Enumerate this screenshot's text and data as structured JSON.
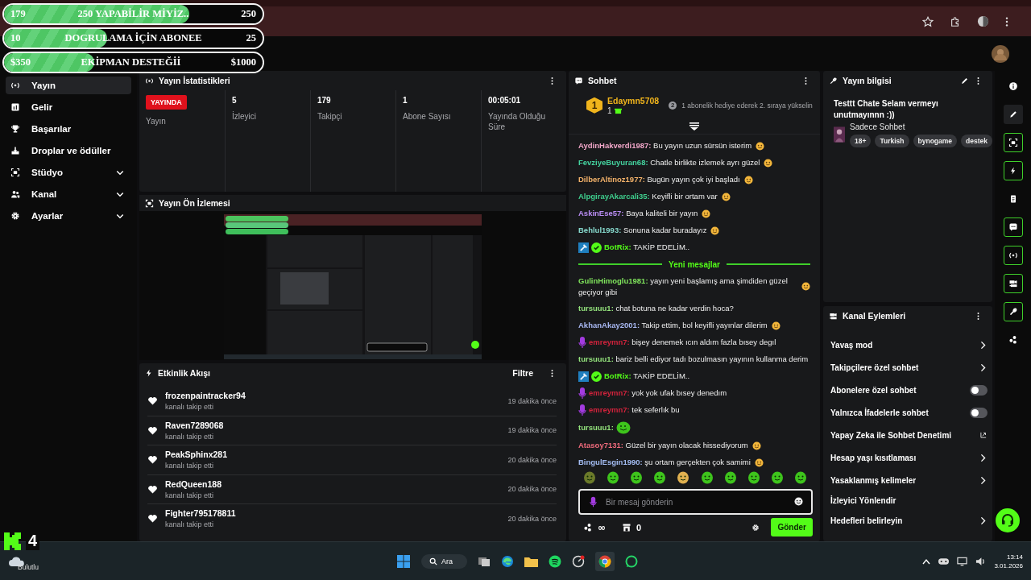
{
  "goals": [
    {
      "current": "179",
      "title": "250 YAPABİLİR MİYİZ..",
      "target": "250",
      "level": 0.716
    },
    {
      "current": "10",
      "title": "DOGRULAMA İÇİN ABONEE",
      "target": "25",
      "level": 0.4
    },
    {
      "current": "$350",
      "title": "EKİPMAN DESTEĞİİ",
      "target": "$1000",
      "level": 0.35
    }
  ],
  "sidebar": {
    "items": [
      {
        "label": "Yayın",
        "kind": "broadcast",
        "selected": true,
        "expandable": false
      },
      {
        "label": "Gelir",
        "kind": "chart",
        "selected": false,
        "expandable": false
      },
      {
        "label": "Başarılar",
        "kind": "trophy",
        "selected": false,
        "expandable": false
      },
      {
        "label": "Droplar ve ödüller",
        "kind": "drops",
        "selected": false,
        "expandable": false
      },
      {
        "label": "Stüdyo",
        "kind": "studio",
        "selected": false,
        "expandable": true
      },
      {
        "label": "Kanal",
        "kind": "people",
        "selected": false,
        "expandable": true
      },
      {
        "label": "Ayarlar",
        "kind": "gear",
        "selected": false,
        "expandable": true
      }
    ]
  },
  "stats": {
    "title": "Yayın İstatistikleri",
    "cells": [
      {
        "kind": "badge",
        "value": "YAYINDA",
        "label": "Yayın"
      },
      {
        "kind": "value",
        "value": "5",
        "label": "İzleyici"
      },
      {
        "kind": "value",
        "value": "179",
        "label": "Takipçi"
      },
      {
        "kind": "value",
        "value": "1",
        "label": "Abone Sayısı"
      },
      {
        "kind": "value",
        "value": "00:05:01",
        "label": "Yayında Olduğu Süre"
      }
    ]
  },
  "preview": {
    "title": "Yayın Ön İzlemesi",
    "kind": "picture"
  },
  "activity": {
    "title": "Etkinlik Akışı",
    "filter": "Filtre",
    "items": [
      {
        "name": "frozenpaintracker94",
        "action": "kanalı takip etti",
        "time": "19 dakika önce"
      },
      {
        "name": "Raven7289068",
        "action": "kanalı takip etti",
        "time": "19 dakika önce"
      },
      {
        "name": "PeakSphinx281",
        "action": "kanalı takip etti",
        "time": "20 dakika önce"
      },
      {
        "name": "RedQueen188",
        "action": "kanalı takip etti",
        "time": "20 dakika önce"
      },
      {
        "name": "Fighter795178811",
        "action": "kanalı takip etti",
        "time": "20 dakika önce"
      }
    ]
  },
  "chat": {
    "title": "Sohbet",
    "leader": {
      "rank": "1",
      "name": "Edaymn5708",
      "count": "1",
      "next_rank": "2",
      "hint": "1 abonelik hediye ederek 2. sıraya yükselin"
    },
    "messages": [
      {
        "kind": "message",
        "user": "AydinHakverdi1987:",
        "color": "#f2a7c9",
        "text": "Bu yayın uzun sürsün isterim",
        "emoji": true
      },
      {
        "kind": "message",
        "user": "FevziyeBuyuran68:",
        "color": "#44d39f",
        "text": "Chatle birlikte izlemek ayrı güzel",
        "emoji": true
      },
      {
        "kind": "message",
        "user": "DilberAltinoz1977:",
        "color": "#f3b26a",
        "text": "Bugün yayın çok iyi başladı",
        "emoji": true
      },
      {
        "kind": "message",
        "user": "AlpgirayAkarcali35:",
        "color": "#3fcf8e",
        "text": "Keyifli bir ortam var",
        "emoji": true
      },
      {
        "kind": "message",
        "user": "AskinEse57:",
        "color": "#b88cf2",
        "text": "Baya kaliteli bir yayın",
        "emoji": true
      },
      {
        "kind": "message",
        "user": "Behlul1993:",
        "color": "#86d8cc",
        "text": "Sonuna kadar buradayız",
        "emoji": true
      },
      {
        "kind": "bot_message",
        "user": "BotRix:",
        "color": "#53fc18",
        "text": "TAKİP EDELİM..",
        "emoji": false
      },
      {
        "kind": "divider",
        "text": "Yeni mesajlar"
      },
      {
        "kind": "message",
        "user": "GulinHimoglu1981:",
        "color": "#7fe35c",
        "text": "yayın yeni başlamış ama şimdiden güzel geçiyor gibi",
        "emoji": true
      },
      {
        "kind": "message",
        "user": "tursuuu1:",
        "color": "#93e27c",
        "text": "chat botuna ne kadar verdin hoca?",
        "emoji": false
      },
      {
        "kind": "message",
        "user": "AkhanAkay2001:",
        "color": "#a8b8f2",
        "text": "Takip ettim, bol keyifli yayınlar dilerim",
        "emoji": true
      },
      {
        "kind": "sub_message",
        "user": "emreymn7:",
        "color": "#d1233c",
        "text": "bişey denemek ıcın aldım fazla bısey degıl",
        "emoji": false
      },
      {
        "kind": "message",
        "user": "tursuuu1:",
        "color": "#93e27c",
        "text": "bariz belli ediyor tadı bozulmasın yayının kullanma derim",
        "emoji": false
      },
      {
        "kind": "bot_message",
        "user": "BotRix:",
        "color": "#53fc18",
        "text": "TAKİP EDELİM..",
        "emoji": false
      },
      {
        "kind": "sub_message",
        "user": "emreymn7:",
        "color": "#d1233c",
        "text": "yok yok ufak bısey denedım",
        "emoji": false
      },
      {
        "kind": "sub_message",
        "user": "emreymn7:",
        "color": "#d1233c",
        "text": "tek seferlık bu",
        "emoji": false
      },
      {
        "kind": "emote",
        "user": "tursuuu1:",
        "color": "#93e27c"
      },
      {
        "kind": "message",
        "user": "Atasoy7131:",
        "color": "#f06b7c",
        "text": "Güzel bir yayın olacak hissediyorum",
        "emoji": true
      },
      {
        "kind": "message",
        "user": "BingulEsgin1990:",
        "color": "#a3bcf2",
        "text": "şu ortam gerçekten çok samimi",
        "emoji": true
      }
    ],
    "input": {
      "placeholder": "Bir mesaj gönderin"
    },
    "points": "∞",
    "shop_count": "0",
    "send": "Gönder"
  },
  "stream_info": {
    "title": "Yayın bilgisi",
    "stream_title": "Testtt Chate Selam vermeyı unutmayınnn :))",
    "category": "Sadece Sohbet",
    "tags": [
      "18+",
      "Turkish",
      "bynogame",
      "destek"
    ]
  },
  "channel_actions": {
    "title": "Kanal Eylemleri",
    "items": [
      {
        "label": "Yavaş mod",
        "kind": "arrow"
      },
      {
        "label": "Takipçilere özel sohbet",
        "kind": "arrow"
      },
      {
        "label": "Abonelere özel sohbet",
        "kind": "toggle",
        "on": false
      },
      {
        "label": "Yalnızca İfadelerle sohbet",
        "kind": "toggle",
        "on": false
      },
      {
        "label": "Yapay Zeka ile Sohbet Denetimi",
        "kind": "external"
      },
      {
        "label": "Hesap yaşı kısıtlaması",
        "kind": "arrow"
      },
      {
        "label": "Yasaklanmış kelimeler",
        "kind": "arrow"
      },
      {
        "label": "İzleyici Yönlendir",
        "kind": "plain"
      },
      {
        "label": "Hedefleri belirleyin",
        "kind": "arrow"
      }
    ]
  },
  "rail": [
    {
      "kind": "info",
      "outlined": false
    },
    {
      "kind": "pencil",
      "outlined": false
    },
    {
      "kind": "screen",
      "outlined": true
    },
    {
      "kind": "bolt",
      "outlined": true
    },
    {
      "kind": "doc",
      "outlined": false
    },
    {
      "kind": "chat",
      "outlined": true
    },
    {
      "kind": "broadcast",
      "outlined": true
    },
    {
      "kind": "camera",
      "outlined": true
    },
    {
      "kind": "wrench",
      "outlined": true
    },
    {
      "kind": "dots",
      "outlined": false
    }
  ],
  "overlay": {
    "count": "4"
  },
  "taskbar": {
    "weather": "Bulutlu",
    "search": "Ara",
    "time": "13:14",
    "date": "3.01.2026"
  }
}
